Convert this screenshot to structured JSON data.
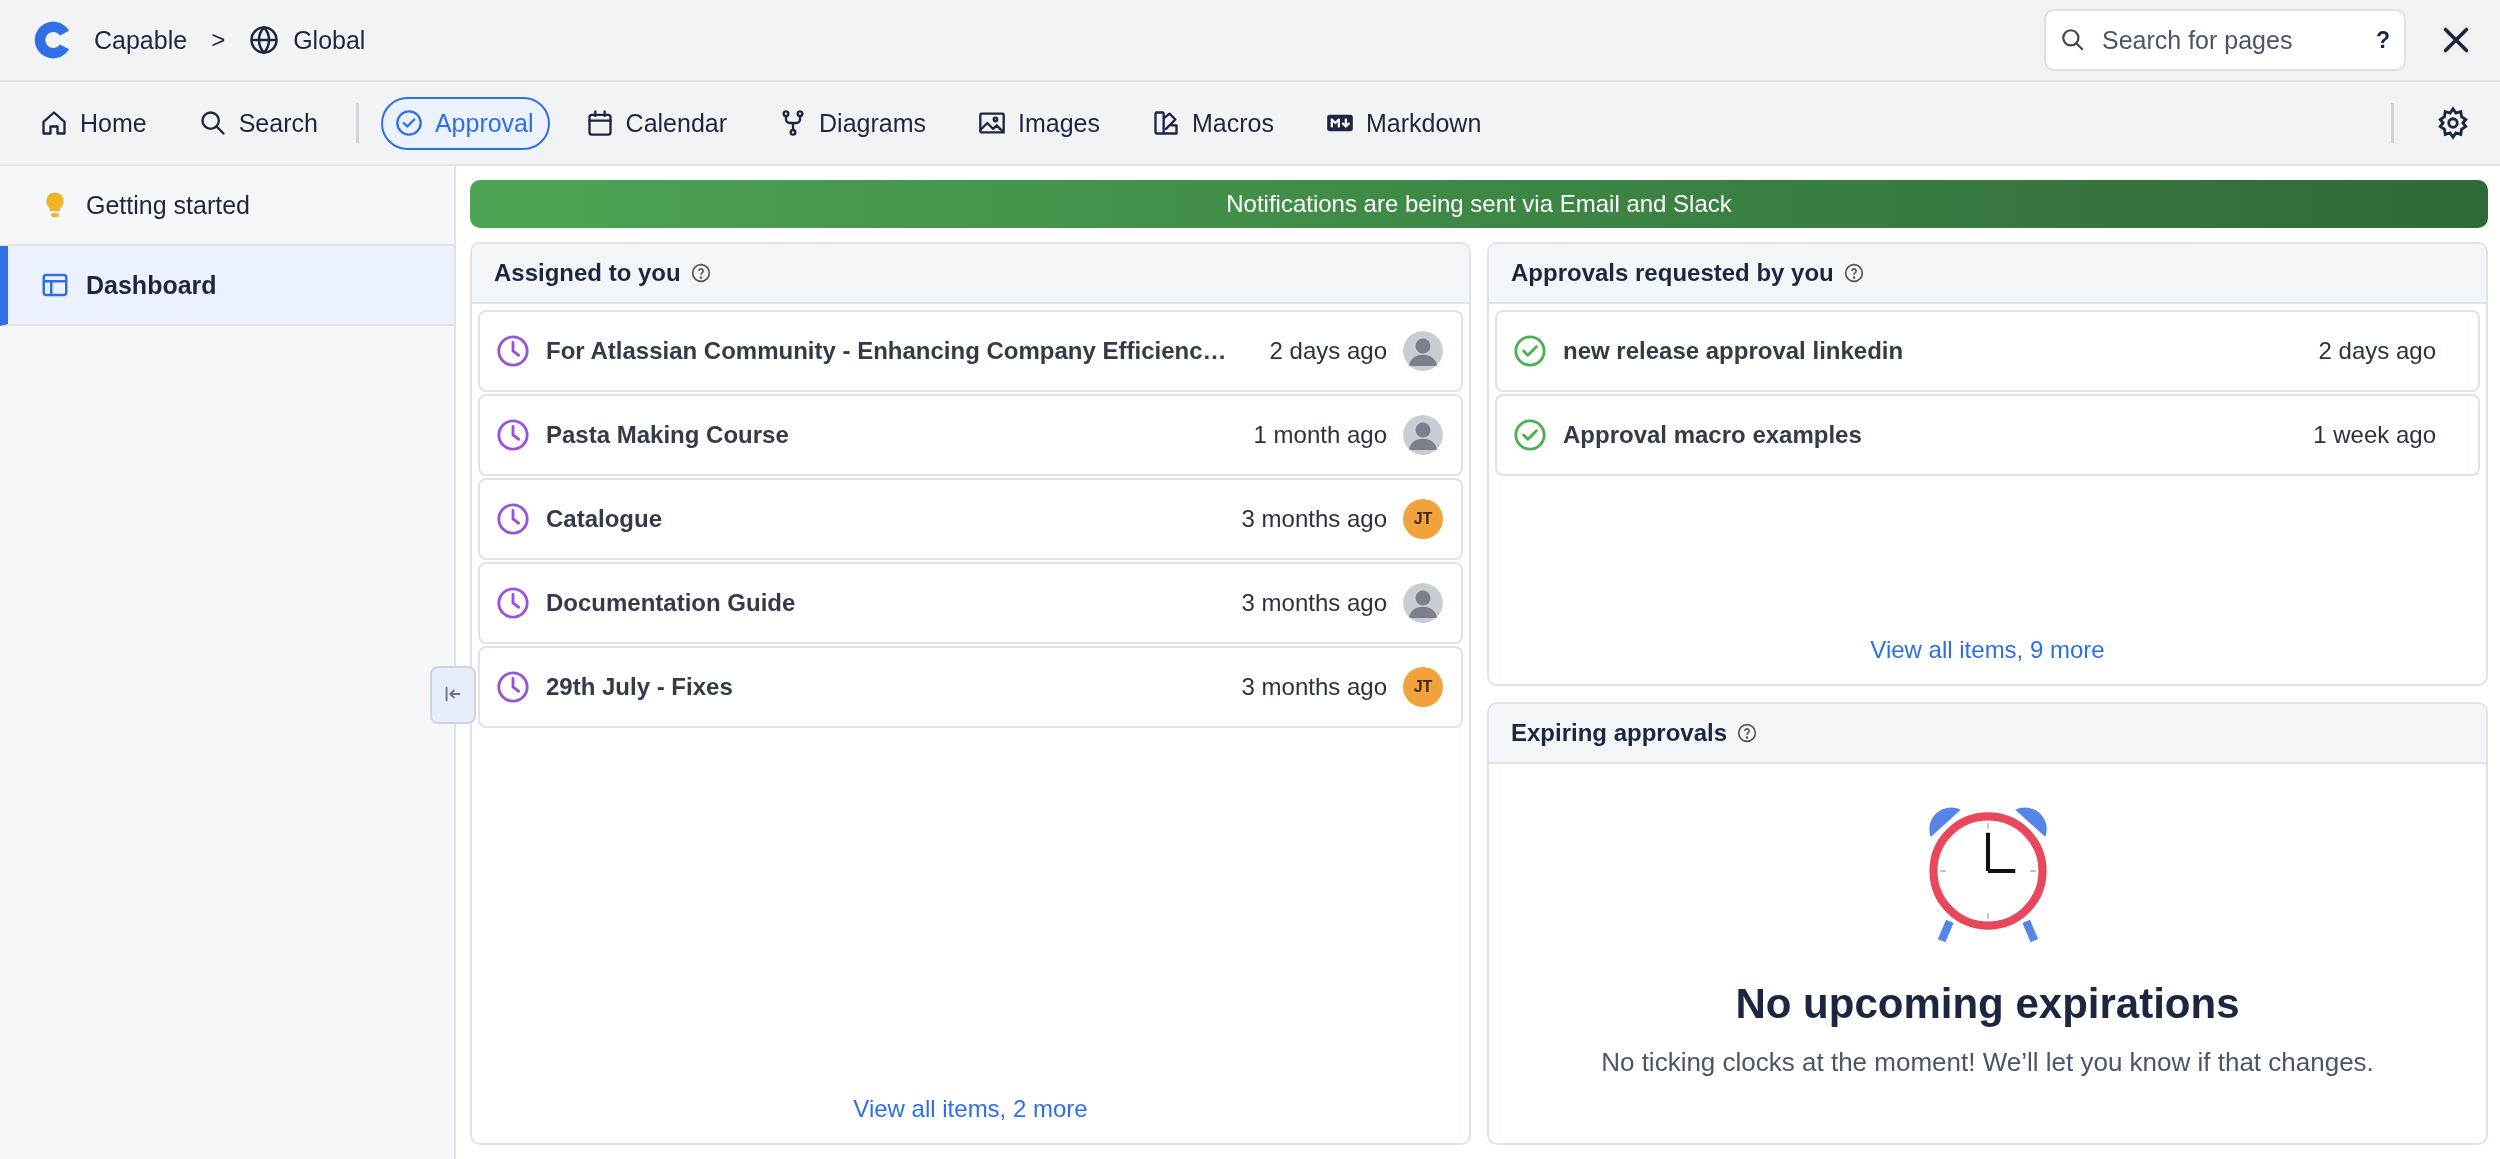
{
  "header": {
    "app_name": "Capable",
    "breadcrumb_separator": ">",
    "space": "Global",
    "search": {
      "placeholder": "Search for pages",
      "help": "?"
    }
  },
  "nav": [
    {
      "kind": "home",
      "label": "Home",
      "selected": false
    },
    {
      "kind": "search",
      "label": "Search",
      "selected": false
    },
    {
      "kind": "approval",
      "label": "Approval",
      "selected": true
    },
    {
      "kind": "calendar",
      "label": "Calendar",
      "selected": false
    },
    {
      "kind": "diagrams",
      "label": "Diagrams",
      "selected": false
    },
    {
      "kind": "images",
      "label": "Images",
      "selected": false
    },
    {
      "kind": "macros",
      "label": "Macros",
      "selected": false
    },
    {
      "kind": "markdown",
      "label": "Markdown",
      "selected": false
    }
  ],
  "sidebar": {
    "items": [
      {
        "kind": "bulb",
        "label": "Getting started",
        "selected": false
      },
      {
        "kind": "dashboard",
        "label": "Dashboard",
        "selected": true
      }
    ]
  },
  "banner": "Notifications are being sent via Email and Slack",
  "assigned": {
    "title": "Assigned to you",
    "items": [
      {
        "title": "For Atlassian Community - Enhancing Company Efficienc…",
        "time": "2 days ago",
        "avatar": {
          "kind": "photo"
        }
      },
      {
        "title": "Pasta Making Course",
        "time": "1 month ago",
        "avatar": {
          "kind": "photo"
        }
      },
      {
        "title": "Catalogue",
        "time": "3 months ago",
        "avatar": {
          "kind": "initials",
          "initials": "JT",
          "color": "#f0a23c"
        }
      },
      {
        "title": "Documentation Guide",
        "time": "3 months ago",
        "avatar": {
          "kind": "photo"
        }
      },
      {
        "title": "29th July - Fixes",
        "time": "3 months ago",
        "avatar": {
          "kind": "initials",
          "initials": "JT",
          "color": "#f0a23c"
        }
      }
    ],
    "link": "View all items, 2 more"
  },
  "requested": {
    "title": "Approvals requested by you",
    "items": [
      {
        "title": "new release approval linkedin",
        "time": "2 days ago"
      },
      {
        "title": "Approval macro examples",
        "time": "1 week ago"
      }
    ],
    "link": "View all items, 9 more"
  },
  "expiring": {
    "title": "Expiring approvals",
    "heading": "No upcoming expirations",
    "text": "No ticking clocks at the moment! We’ll let you know if that changes."
  }
}
